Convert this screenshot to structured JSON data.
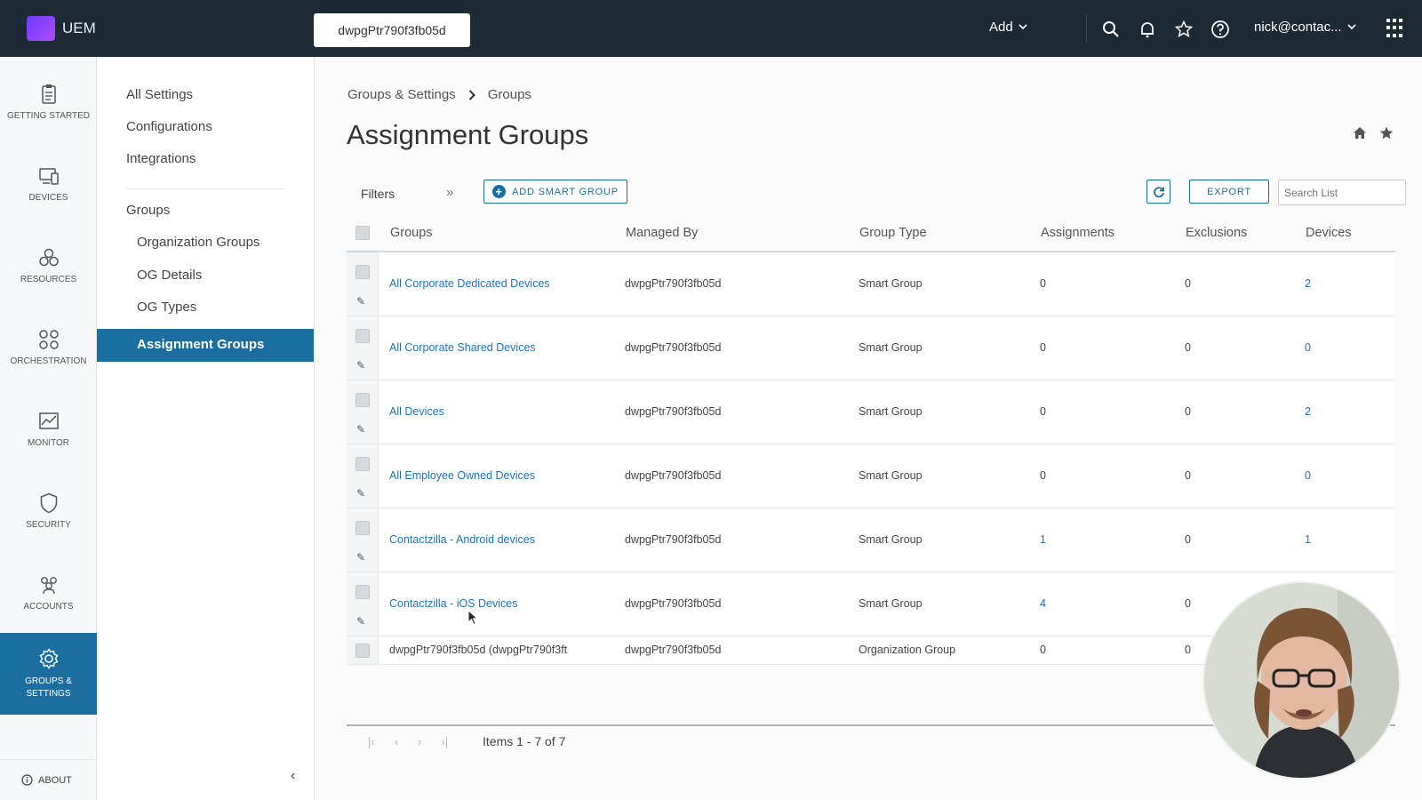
{
  "topbar": {
    "app_name": "UEM",
    "og_selector": "dwpgPtr790f3fb05d",
    "add_label": "Add",
    "user": "nick@contac..."
  },
  "rail": {
    "items": [
      {
        "label": "GETTING STARTED",
        "icon": "clipboard-icon"
      },
      {
        "label": "DEVICES",
        "icon": "devices-icon"
      },
      {
        "label": "RESOURCES",
        "icon": "resources-icon"
      },
      {
        "label": "ORCHESTRATION",
        "icon": "orchestration-icon"
      },
      {
        "label": "MONITOR",
        "icon": "monitor-icon"
      },
      {
        "label": "SECURITY",
        "icon": "shield-icon"
      },
      {
        "label": "ACCOUNTS",
        "icon": "accounts-icon"
      },
      {
        "label": "GROUPS & SETTINGS",
        "icon": "gear-icon"
      }
    ],
    "about": "ABOUT"
  },
  "subnav": {
    "all_settings": "All Settings",
    "configurations": "Configurations",
    "integrations": "Integrations",
    "groups": "Groups",
    "organization_groups": "Organization Groups",
    "og_details": "OG Details",
    "og_types": "OG Types",
    "assignment_groups": "Assignment Groups"
  },
  "breadcrumb": {
    "parent": "Groups & Settings",
    "current": "Groups"
  },
  "page_title": "Assignment Groups",
  "toolbar": {
    "filters": "Filters",
    "add_smart_group": "ADD SMART GROUP",
    "export": "EXPORT",
    "search_placeholder": "Search List"
  },
  "table": {
    "columns": [
      "Groups",
      "Managed By",
      "Group Type",
      "Assignments",
      "Exclusions",
      "Devices"
    ],
    "rows": [
      {
        "group": "All Corporate Dedicated Devices",
        "managed_by": "dwpgPtr790f3fb05d",
        "type": "Smart Group",
        "assignments": "0",
        "exclusions": "0",
        "devices": "2"
      },
      {
        "group": "All Corporate Shared Devices",
        "managed_by": "dwpgPtr790f3fb05d",
        "type": "Smart Group",
        "assignments": "0",
        "exclusions": "0",
        "devices": "0"
      },
      {
        "group": "All Devices",
        "managed_by": "dwpgPtr790f3fb05d",
        "type": "Smart Group",
        "assignments": "0",
        "exclusions": "0",
        "devices": "2"
      },
      {
        "group": "All Employee Owned Devices",
        "managed_by": "dwpgPtr790f3fb05d",
        "type": "Smart Group",
        "assignments": "0",
        "exclusions": "0",
        "devices": "0"
      },
      {
        "group": "Contactzilla - Android devices",
        "managed_by": "dwpgPtr790f3fb05d",
        "type": "Smart Group",
        "assignments": "1",
        "exclusions": "0",
        "devices": "1"
      },
      {
        "group": "Contactzilla - iOS Devices",
        "managed_by": "dwpgPtr790f3fb05d",
        "type": "Smart Group",
        "assignments": "4",
        "exclusions": "0",
        "devices": ""
      },
      {
        "group": "dwpgPtr790f3fb05d (dwpgPtr790f3ft",
        "managed_by": "dwpgPtr790f3fb05d",
        "type": "Organization Group",
        "assignments": "0",
        "exclusions": "0",
        "devices": ""
      }
    ]
  },
  "pager": {
    "text": "Items 1 - 7 of 7"
  },
  "colors": {
    "accent": "#1a6ea0",
    "topbar": "#1c2a36",
    "link": "#1f74b8"
  }
}
